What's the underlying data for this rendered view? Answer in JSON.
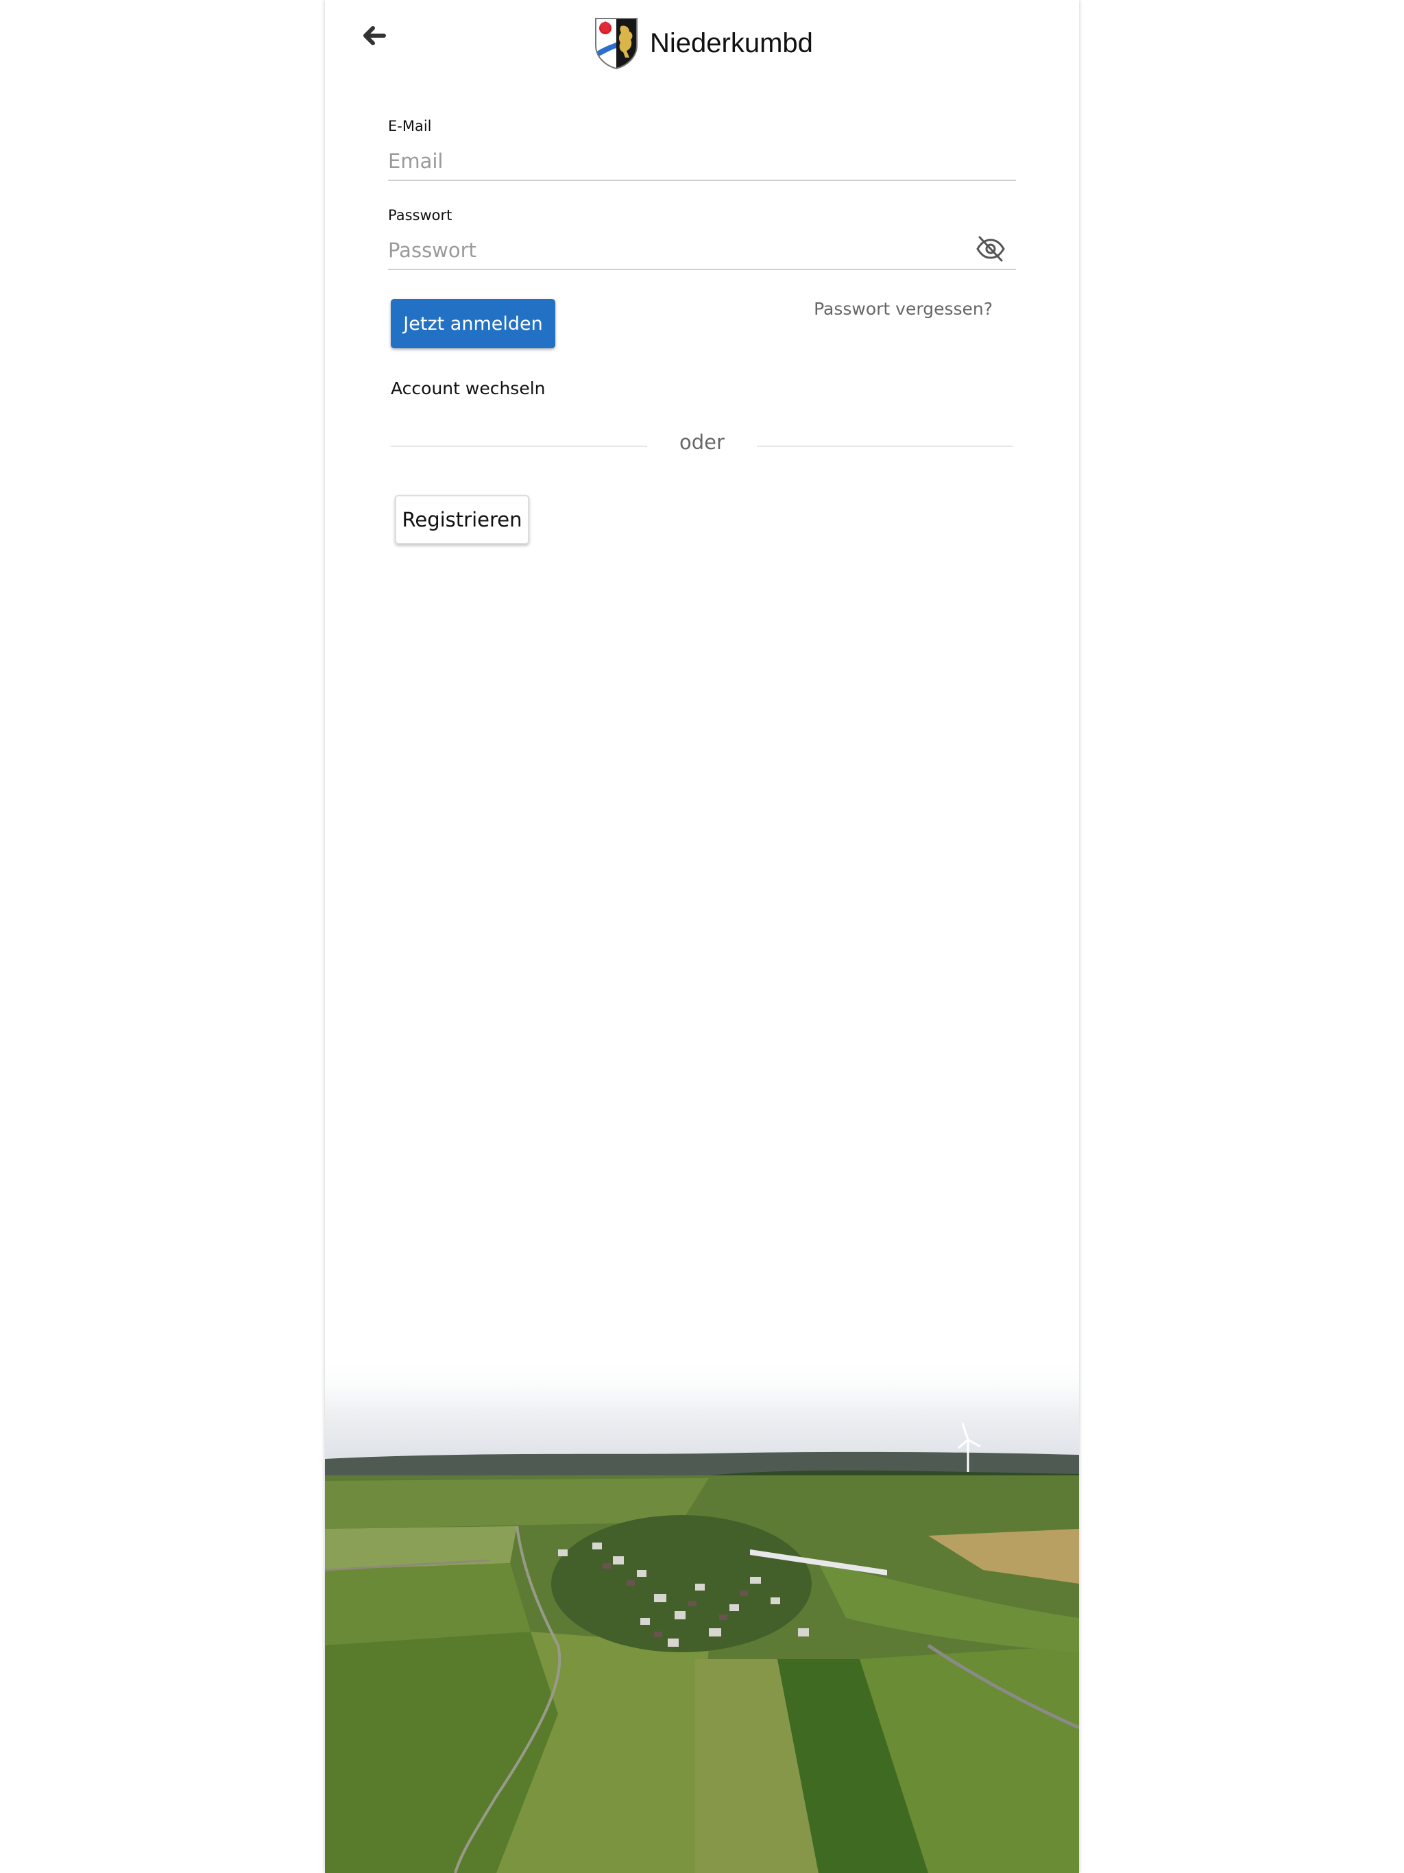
{
  "header": {
    "back_icon": "arrow-left-icon",
    "brand_name": "Niederkumbd",
    "crest_icon": "coat-of-arms-icon"
  },
  "form": {
    "email": {
      "label": "E-Mail",
      "placeholder": "Email",
      "value": ""
    },
    "password": {
      "label": "Passwort",
      "placeholder": "Passwort",
      "value": "",
      "toggle_icon": "eye-off-icon"
    },
    "login_button": "Jetzt anmelden",
    "forgot_password": "Passwort vergessen?",
    "switch_account": "Account wechseln",
    "divider_text": "oder",
    "register_button": "Registrieren"
  },
  "colors": {
    "primary": "#2271c4",
    "background": "#ffffff",
    "muted_text": "#666666",
    "placeholder": "#9a9a9a"
  },
  "background_image": "aerial-village-landscape"
}
